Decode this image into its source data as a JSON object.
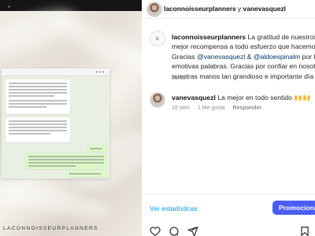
{
  "media": {
    "caption_watermark": "LACONNOISSEURPLANNERS"
  },
  "header": {
    "account": "laconnoisseurplanners",
    "connector": "y",
    "collaborator": "vanevasquezl",
    "avatar_text": "lc"
  },
  "post": {
    "author": "laconnoisseurplanners",
    "caption_lines": [
      "La gratitud de nuestros n",
      "mejor recompensa a todo esfuerzo que hacemos c",
      "Gracias",
      "emotivas palabras. Gracias por confiar en nosotros",
      "nuestras manos tan grandioso e importante día en"
    ],
    "line1_rest": "La gratitud de nuestros n",
    "line2": "mejor recompensa a todo esfuerzo que hacemos c",
    "line3_pre": "Gracias ",
    "mention1": "@vanevasquezl",
    "line3_mid": " & ",
    "mention2": "@aldoespinalm",
    "line3_post": " por las",
    "line4": "emotivas palabras. Gracias por confiar en nosotros",
    "line5": "nuestras manos tan grandioso e importante día en",
    "time": "10 sem"
  },
  "comment": {
    "author": "vanevasquezl",
    "text": "La mejor en todo sentido 🙌🙌",
    "time": "10 sem",
    "likes": "1 Me gusta",
    "reply": "Responder"
  },
  "footer": {
    "stats_link": "Ver estadísticas",
    "promote_button": "Promocionar"
  },
  "icons": [
    "heart-icon",
    "comment-icon",
    "share-icon",
    "save-icon"
  ]
}
